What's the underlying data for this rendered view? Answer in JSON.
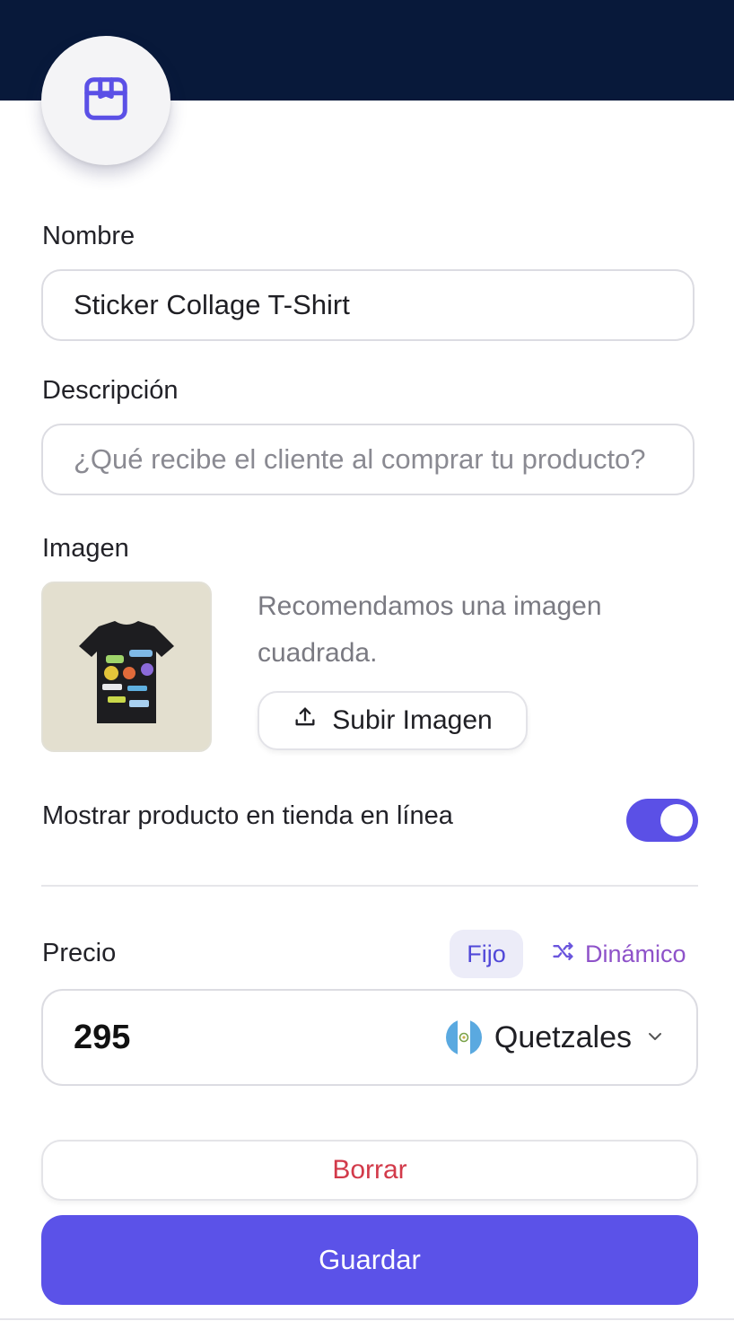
{
  "header": {
    "icon": "package-icon"
  },
  "form": {
    "name": {
      "label": "Nombre",
      "value": "Sticker Collage T-Shirt"
    },
    "description": {
      "label": "Descripción",
      "value": "",
      "placeholder": "¿Qué recibe el cliente al comprar tu producto?"
    },
    "image": {
      "label": "Imagen",
      "hint": "Recomendamos una imagen cuadrada.",
      "upload_label": "Subir Imagen",
      "upload_icon": "upload-icon",
      "thumbnail": "black t-shirt with colorful stickers"
    },
    "online_store": {
      "label": "Mostrar producto en tienda en línea",
      "enabled": true
    },
    "price": {
      "label": "Precio",
      "mode_fixed": "Fijo",
      "mode_dynamic": "Dinámico",
      "selected_mode": "Fijo",
      "value": "295",
      "currency": "Quetzales",
      "currency_flag": "guatemala-flag-icon"
    }
  },
  "actions": {
    "delete_label": "Borrar",
    "save_label": "Guardar"
  },
  "colors": {
    "header_bg": "#08193a",
    "accent": "#5b52e8",
    "danger": "#d23a4a",
    "dynamic": "#8e52c9"
  }
}
